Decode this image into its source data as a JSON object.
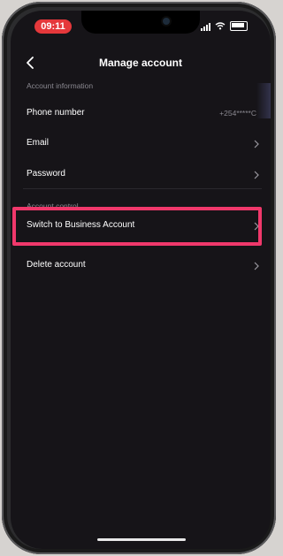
{
  "status_bar": {
    "time": "09:11"
  },
  "header": {
    "title": "Manage account"
  },
  "sections": {
    "account_information": {
      "label": "Account information",
      "phone": {
        "label": "Phone number",
        "value": "+254*****C"
      },
      "email": {
        "label": "Email"
      },
      "password": {
        "label": "Password"
      }
    },
    "account_control": {
      "label": "Account control",
      "switch_business": {
        "label": "Switch to Business Account"
      },
      "delete_account": {
        "label": "Delete account"
      }
    }
  },
  "colors": {
    "background": "#161418",
    "highlight_border": "#f0386b",
    "time_pill": "#e5383b",
    "muted_text": "#8a8890"
  }
}
